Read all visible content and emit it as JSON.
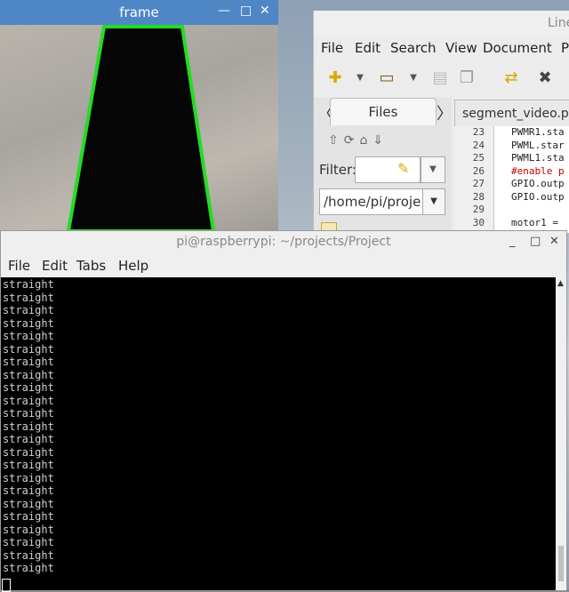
{
  "frame_window": {
    "title": "frame",
    "controls": {
      "minimize": "—",
      "maximize": "□",
      "close": "✕"
    }
  },
  "geany": {
    "title_partial": "Line",
    "menu": [
      "File",
      "Edit",
      "Search",
      "View",
      "Document",
      "P"
    ],
    "side_tab": "Files",
    "filter_label": "Filter:",
    "path": "/home/pi/proje",
    "editor_tab": "segment_video.py",
    "lines": [
      {
        "num": "23",
        "code": "PWMR1.sta",
        "comment": false
      },
      {
        "num": "24",
        "code": "PWML.star",
        "comment": false
      },
      {
        "num": "25",
        "code": "PWML1.sta",
        "comment": false
      },
      {
        "num": "26",
        "code": "#enable p",
        "comment": true
      },
      {
        "num": "27",
        "code": "GPIO.outp",
        "comment": false
      },
      {
        "num": "28",
        "code": "GPIO.outp",
        "comment": false
      },
      {
        "num": "29",
        "code": "",
        "comment": false
      },
      {
        "num": "30",
        "code": "motor1 =",
        "comment": false
      }
    ]
  },
  "terminal": {
    "title": "pi@raspberrypi: ~/projects/Project",
    "controls": {
      "minimize": "_",
      "maximize": "□",
      "close": "✕"
    },
    "menu": [
      "File",
      "Edit",
      "Tabs",
      "Help"
    ],
    "output": [
      "straight",
      "straight",
      "straight",
      "straight",
      "straight",
      "straight",
      "straight",
      "straight",
      "straight",
      "straight",
      "straight",
      "straight",
      "straight",
      "straight",
      "straight",
      "straight",
      "straight",
      "straight",
      "straight",
      "straight",
      "straight",
      "straight",
      "straight"
    ]
  }
}
